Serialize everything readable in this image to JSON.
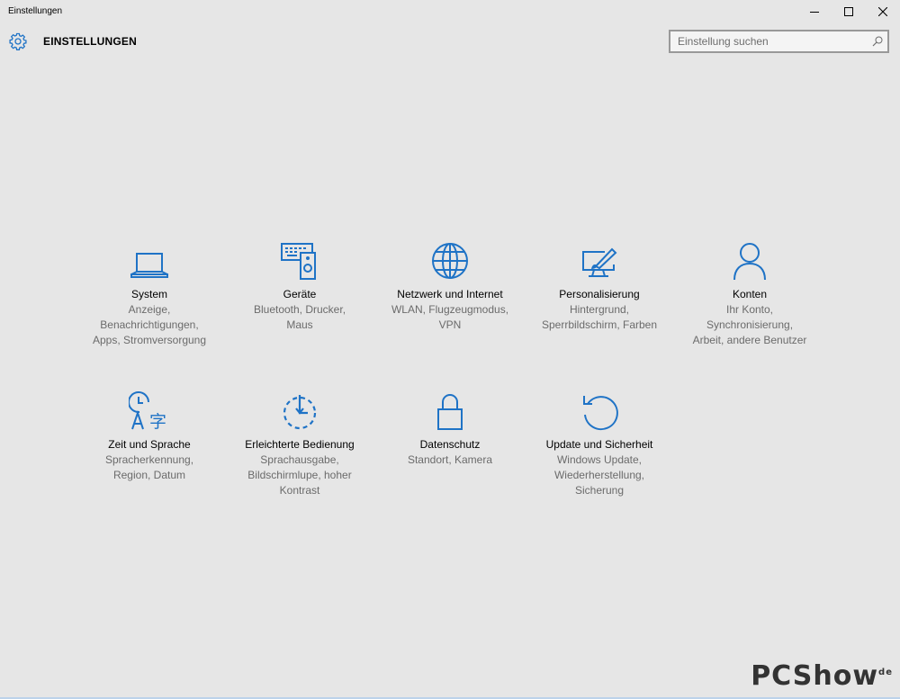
{
  "window": {
    "title": "Einstellungen",
    "controls": [
      "minimize-icon",
      "maximize-icon",
      "close-icon"
    ]
  },
  "header": {
    "icon": "gear-icon",
    "title": "EINSTELLUNGEN"
  },
  "search": {
    "placeholder": "Einstellung suchen",
    "value": "",
    "icon": "search-icon"
  },
  "accent_color": "#1f73c6",
  "categories": [
    {
      "icon": "laptop-icon",
      "name": "System",
      "desc": [
        "Anzeige,",
        "Benachrichtigungen,",
        "Apps, Stromversorgung"
      ]
    },
    {
      "icon": "devices-icon",
      "name": "Geräte",
      "desc": [
        "Bluetooth, Drucker,",
        "Maus"
      ]
    },
    {
      "icon": "globe-icon",
      "name": "Netzwerk und Internet",
      "desc": [
        "WLAN, Flugzeugmodus,",
        "VPN"
      ]
    },
    {
      "icon": "personalization-icon",
      "name": "Personalisierung",
      "desc": [
        "Hintergrund,",
        "Sperrbildschirm, Farben"
      ]
    },
    {
      "icon": "person-icon",
      "name": "Konten",
      "desc": [
        "Ihr Konto,",
        "Synchronisierung,",
        "Arbeit, andere Benutzer"
      ]
    },
    {
      "icon": "time-language-icon",
      "name": "Zeit und Sprache",
      "desc": [
        "Spracherkennung,",
        "Region, Datum"
      ]
    },
    {
      "icon": "ease-of-access-icon",
      "name": "Erleichterte Bedienung",
      "desc": [
        "Sprachausgabe,",
        "Bildschirmlupe, hoher",
        "Kontrast"
      ]
    },
    {
      "icon": "lock-icon",
      "name": "Datenschutz",
      "desc": [
        "Standort, Kamera"
      ]
    },
    {
      "icon": "update-icon",
      "name": "Update und Sicherheit",
      "desc": [
        "Windows Update,",
        "Wiederherstellung,",
        "Sicherung"
      ]
    }
  ],
  "watermark": {
    "text": "PCShow",
    "suffix": "de"
  }
}
